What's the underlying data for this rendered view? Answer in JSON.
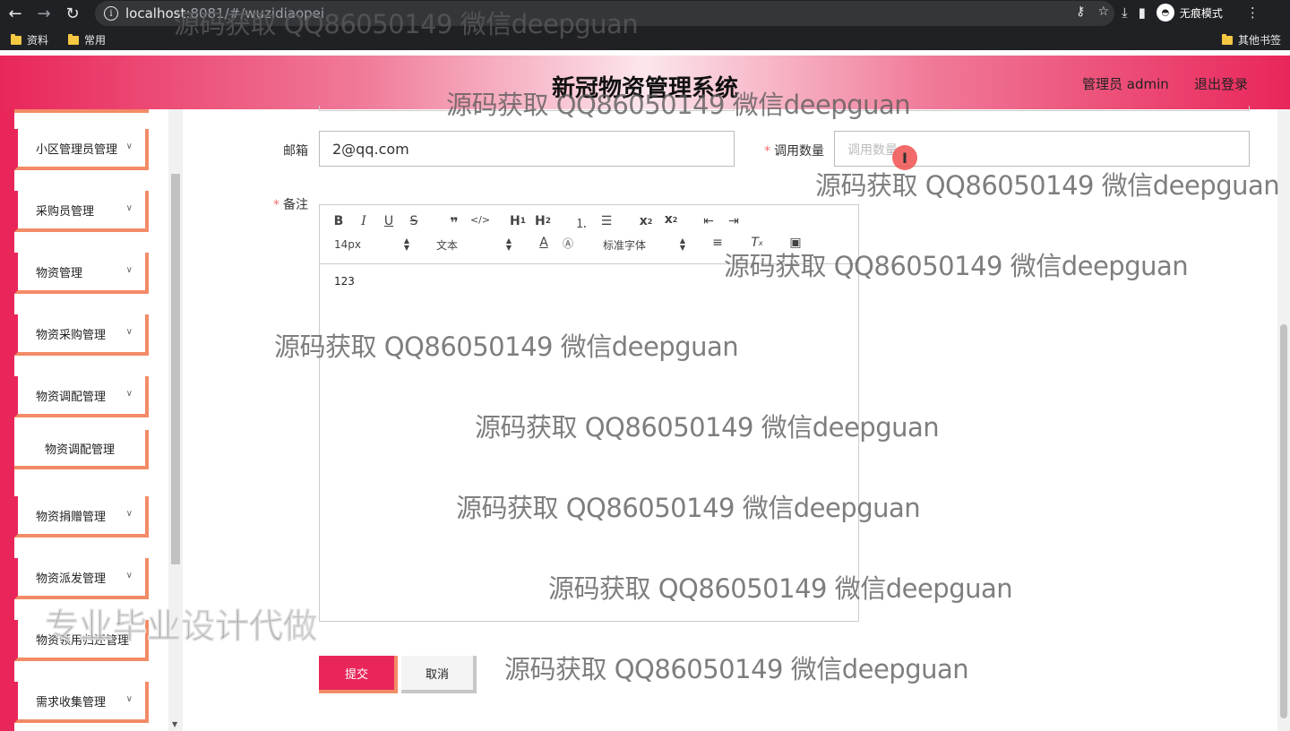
{
  "browser": {
    "url_host": "localhost",
    "url_rest": ":8081/#/wuzidiaopei",
    "incognito_label": "无痕模式",
    "bookmarks": [
      "资料",
      "常用"
    ],
    "other_bookmarks": "其他书签"
  },
  "header": {
    "title": "新冠物资管理系统",
    "user": "管理员 admin",
    "logout": "退出登录"
  },
  "sidebar": {
    "items": [
      {
        "label": "小区管理员管理"
      },
      {
        "label": "采购员管理"
      },
      {
        "label": "物资管理"
      },
      {
        "label": "物资采购管理"
      },
      {
        "label": "物资调配管理"
      },
      {
        "label": "物资调配管理"
      },
      {
        "label": "物资捐赠管理"
      },
      {
        "label": "物资派发管理"
      },
      {
        "label": "物资领用归还管理"
      },
      {
        "label": "需求收集管理"
      }
    ]
  },
  "form": {
    "email_label": "邮箱",
    "email_value": "2@qq.com",
    "quantity_label": "调用数量",
    "quantity_placeholder": "调用数量",
    "remark_label": "备注",
    "remark_content": "123",
    "submit_label": "提交",
    "cancel_label": "取消"
  },
  "editor_toolbar": {
    "font_size": "14px",
    "paragraph": "文本",
    "font_family": "标准字体"
  },
  "watermarks": {
    "text": "源码获取 QQ86050149 微信deepguan",
    "big": "专业毕业设计代做"
  }
}
